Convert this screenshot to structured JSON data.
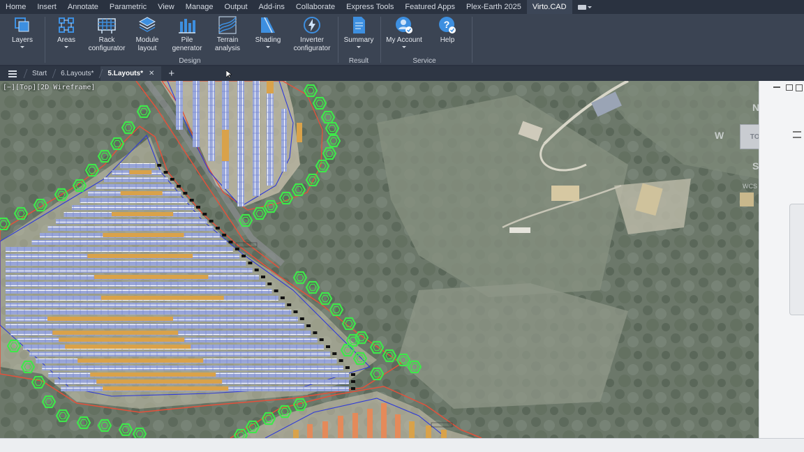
{
  "menu": {
    "items": [
      "Home",
      "Insert",
      "Annotate",
      "Parametric",
      "View",
      "Manage",
      "Output",
      "Add-ins",
      "Collaborate",
      "Express Tools",
      "Featured Apps",
      "Plex-Earth 2025",
      "Virto.CAD"
    ],
    "active_index": 12
  },
  "ribbon": {
    "buttons": {
      "layers": "Layers",
      "areas": "Areas",
      "rack_1": "Rack",
      "rack_2": "configurator",
      "module_1": "Module",
      "module_2": "layout",
      "pile_1": "Pile",
      "pile_2": "generator",
      "terrain_1": "Terrain",
      "terrain_2": "analysis",
      "shading": "Shading",
      "inverter_1": "Inverter",
      "inverter_2": "configurator",
      "summary": "Summary",
      "myaccount": "My Account",
      "help": "Help"
    },
    "groups": {
      "design": "Design",
      "result": "Result",
      "service": "Service"
    }
  },
  "tabs": {
    "start": "Start",
    "layouts6": "6.Layouts*",
    "layouts5": "5.Layouts*",
    "close": "✕",
    "new": "+"
  },
  "viewport": {
    "label": "[−][Top][2D Wireframe]",
    "viewcube": {
      "top": "TOP",
      "north": "N",
      "west": "W",
      "south": "S",
      "wcs": "WCS"
    }
  },
  "colors": {
    "menubar": "#2a3240",
    "ribbon": "#3b4453",
    "accent_blue": "#3d8fe0",
    "panel_blue": "#8fa6e6",
    "panel_orange": "#d9a24a",
    "tree_green": "#3ee84a",
    "boundary_red": "#e5503a",
    "boundary_blue": "#2e3ad8"
  }
}
